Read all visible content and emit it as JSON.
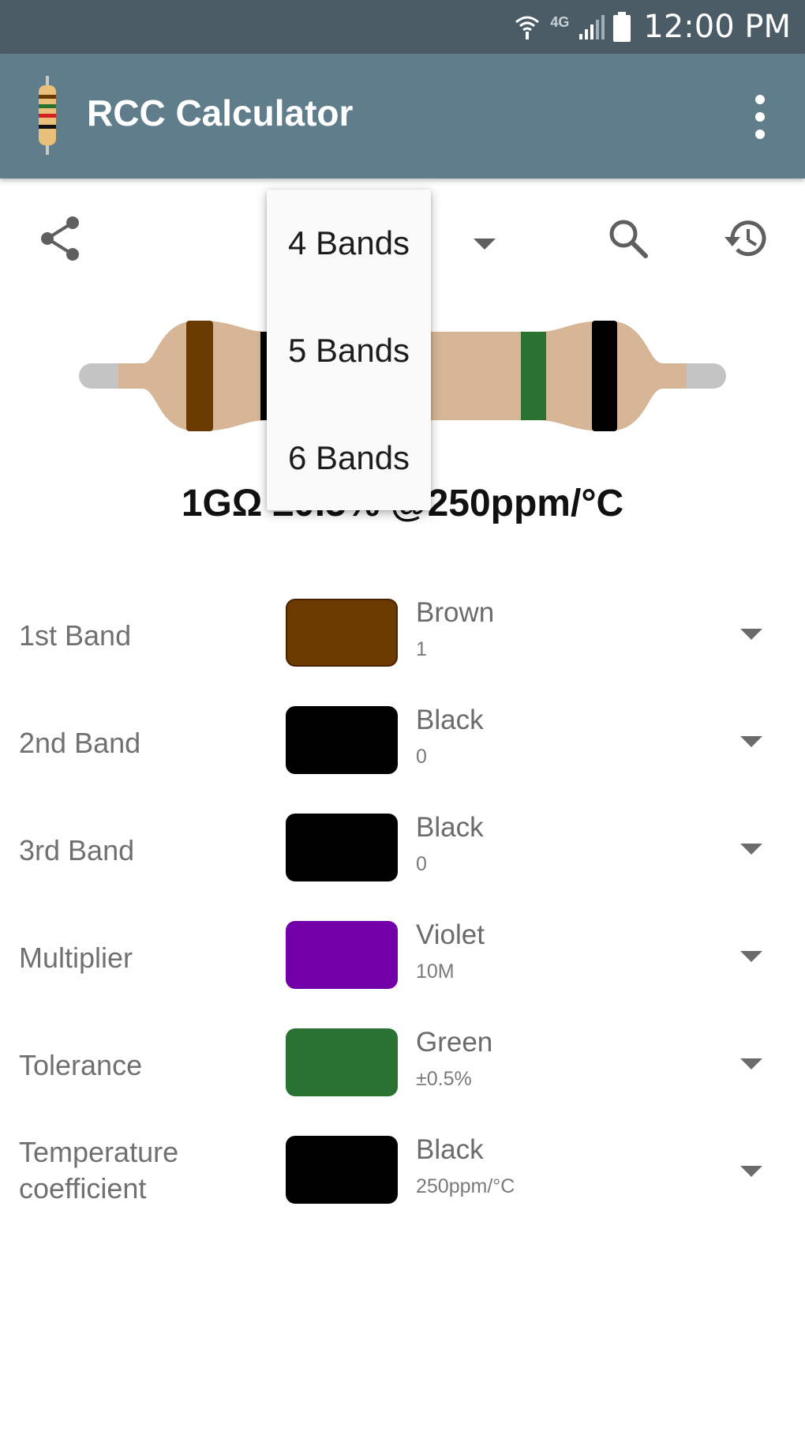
{
  "status_bar": {
    "network_label": "4G",
    "time": "12:00 PM",
    "icons": [
      "wifi-icon",
      "signal-icon",
      "battery-icon"
    ]
  },
  "app_bar": {
    "title": "RCC Calculator",
    "background": "#607d8b",
    "menu_icon": "more-vert-icon"
  },
  "toolbar": {
    "icons": [
      "share-icon",
      "search-icon",
      "history-icon"
    ]
  },
  "band_selector": {
    "options": [
      "4 Bands",
      "5 Bands",
      "6 Bands"
    ]
  },
  "result": {
    "text": "1GΩ ±0.5% @250ppm/°C"
  },
  "bands": [
    {
      "label": "1st Band",
      "color_name": "Brown",
      "value": "1",
      "color": "#6b3a00"
    },
    {
      "label": "2nd Band",
      "color_name": "Black",
      "value": "0",
      "color": "#000000"
    },
    {
      "label": "3rd Band",
      "color_name": "Black",
      "value": "0",
      "color": "#000000"
    },
    {
      "label": "Multiplier",
      "color_name": "Violet",
      "value": "10M",
      "color": "#7200a8"
    },
    {
      "label": "Tolerance",
      "color_name": "Green",
      "value": "±0.5%",
      "color": "#2a7232"
    },
    {
      "label": "Temperature coefficient",
      "color_name": "Black",
      "value": "250ppm/°C",
      "color": "#000000"
    }
  ],
  "colors": {
    "resistor_body": "#d6b697",
    "resistor_lead": "#c4c4c4"
  }
}
